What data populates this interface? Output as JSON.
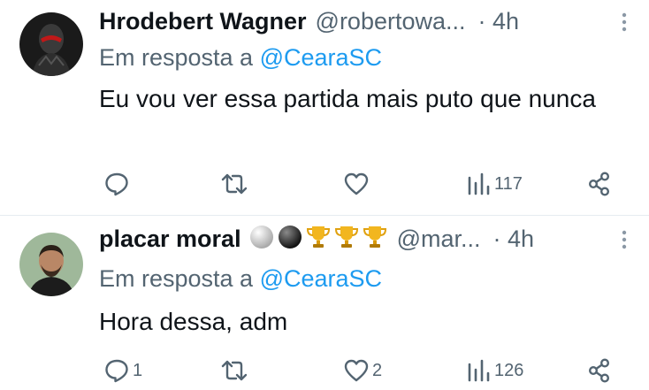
{
  "tweets": [
    {
      "name": "Hrodebert Wagner",
      "emojis": [],
      "handle": "@robertowa...",
      "time": "· 4h",
      "reply_prefix": "Em resposta a ",
      "reply_to": "@CearaSC",
      "text": "Eu vou ver essa partida mais puto que nunca",
      "replies": "",
      "retweets": "",
      "likes": "",
      "views": "117"
    },
    {
      "name": "placar moral",
      "emojis": [
        "white-ball-emoji",
        "black-ball-emoji",
        "trophy-emoji",
        "trophy-emoji",
        "trophy-emoji"
      ],
      "handle": "@mar...",
      "time": "· 4h",
      "reply_prefix": "Em resposta a ",
      "reply_to": "@CearaSC",
      "text": "Hora dessa, adm",
      "replies": "1",
      "retweets": "",
      "likes": "2",
      "views": "126"
    }
  ],
  "colors": {
    "secondary": "#536471",
    "link": "#1d9bf0",
    "text": "#0f1419"
  }
}
